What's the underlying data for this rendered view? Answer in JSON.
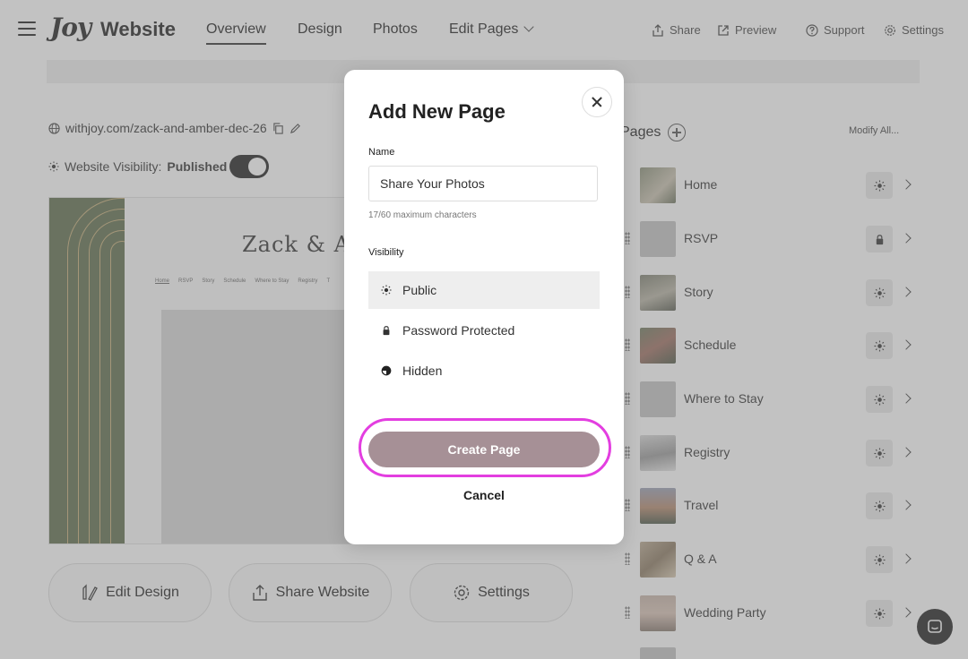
{
  "header": {
    "logo": "Joy",
    "app_title": "Website",
    "tabs": [
      {
        "label": "Overview"
      },
      {
        "label": "Design"
      },
      {
        "label": "Photos"
      },
      {
        "label": "Edit Pages"
      }
    ],
    "actions": {
      "share": "Share",
      "preview": "Preview",
      "support": "Support",
      "settings": "Settings"
    }
  },
  "website": {
    "url": "withjoy.com/zack-and-amber-dec-26",
    "visibility_prefix": "Website Visibility:",
    "visibility_value": "Published",
    "preview_title": "Zack & Am",
    "preview_nav": [
      "Home",
      "RSVP",
      "Story",
      "Schedule",
      "Where to Stay",
      "Registry",
      "T"
    ]
  },
  "actions": {
    "edit_design": "Edit Design",
    "share_website": "Share Website",
    "settings": "Settings"
  },
  "pages": {
    "title": "Pages",
    "modify_all": "Modify All...",
    "items": [
      {
        "label": "Home",
        "status": "public"
      },
      {
        "label": "RSVP",
        "status": "locked"
      },
      {
        "label": "Story",
        "status": "public"
      },
      {
        "label": "Schedule",
        "status": "public"
      },
      {
        "label": "Where to Stay",
        "status": "public"
      },
      {
        "label": "Registry",
        "status": "public"
      },
      {
        "label": "Travel",
        "status": "public"
      },
      {
        "label": "Q & A",
        "status": "public"
      },
      {
        "label": "Wedding Party",
        "status": "public"
      }
    ]
  },
  "modal": {
    "title": "Add New Page",
    "name_label": "Name",
    "name_value": "Share Your Photos",
    "char_hint": "17/60 maximum characters",
    "visibility_label": "Visibility",
    "options": [
      {
        "label": "Public",
        "icon": "sun-icon",
        "selected": true
      },
      {
        "label": "Password Protected",
        "icon": "lock-icon",
        "selected": false
      },
      {
        "label": "Hidden",
        "icon": "half-circle-icon",
        "selected": false
      }
    ],
    "create_label": "Create Page",
    "cancel_label": "Cancel"
  },
  "colors": {
    "create_button": "#a69096",
    "highlight_ring": "#e33ee0",
    "preview_side": "#5f6e4e"
  }
}
